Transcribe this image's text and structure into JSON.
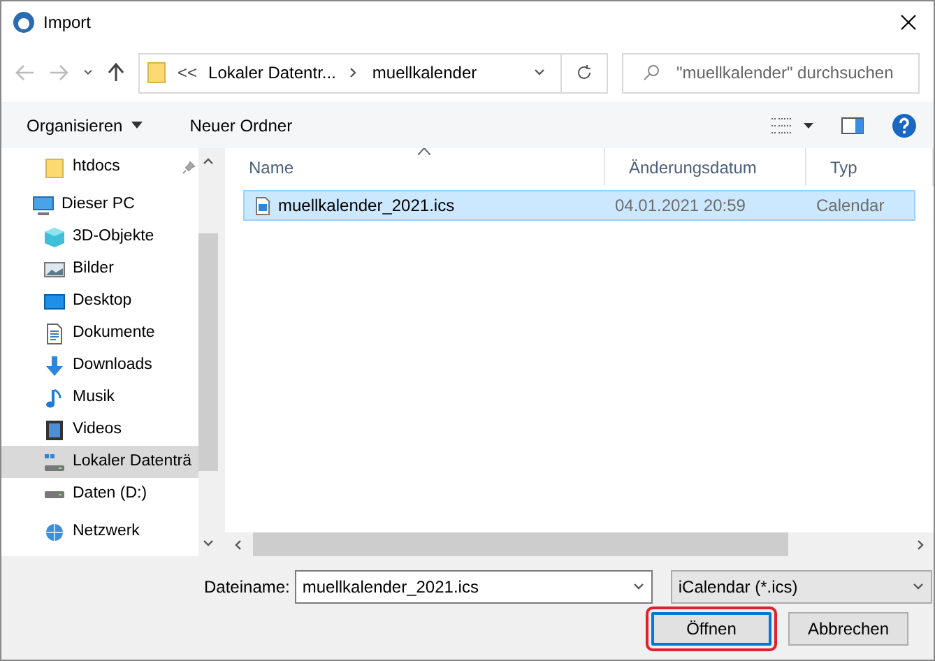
{
  "window": {
    "title": "Import"
  },
  "address": {
    "prefix": "<<",
    "segments": [
      "Lokaler Datentr...",
      "muellkalender"
    ]
  },
  "search": {
    "placeholder": "\"muellkalender\" durchsuchen"
  },
  "toolbar": {
    "organize": "Organisieren",
    "new_folder": "Neuer Ordner"
  },
  "sidebar": {
    "items": [
      {
        "label": "htdocs",
        "kind": "folder",
        "pinned": true,
        "selected": false
      },
      {
        "label": "Dieser PC",
        "kind": "pc",
        "selected": false,
        "children": [
          {
            "label": "3D-Objekte",
            "kind": "cube",
            "selected": false
          },
          {
            "label": "Bilder",
            "kind": "pictures",
            "selected": false
          },
          {
            "label": "Desktop",
            "kind": "desktop",
            "selected": false
          },
          {
            "label": "Dokumente",
            "kind": "documents",
            "selected": false
          },
          {
            "label": "Downloads",
            "kind": "downloads",
            "selected": false
          },
          {
            "label": "Musik",
            "kind": "music",
            "selected": false
          },
          {
            "label": "Videos",
            "kind": "videos",
            "selected": false
          },
          {
            "label": "Lokaler Datenträ",
            "kind": "system-drive",
            "selected": true
          },
          {
            "label": "Daten (D:)",
            "kind": "drive",
            "selected": false
          }
        ]
      },
      {
        "label": "Netzwerk",
        "kind": "network",
        "selected": false
      }
    ]
  },
  "table": {
    "columns": [
      "Name",
      "Änderungsdatum",
      "Typ"
    ],
    "rows": [
      {
        "name": "muellkalender_2021.ics",
        "date": "04.01.2021 20:59",
        "type": "Calendar",
        "selected": true
      }
    ]
  },
  "filename": {
    "label": "Dateiname:",
    "value": "muellkalender_2021.ics"
  },
  "filetype": {
    "value": "iCalendar (*.ics)"
  },
  "buttons": [
    {
      "label": "Öffnen",
      "default": true
    },
    {
      "label": "Abbrechen",
      "default": false
    }
  ]
}
